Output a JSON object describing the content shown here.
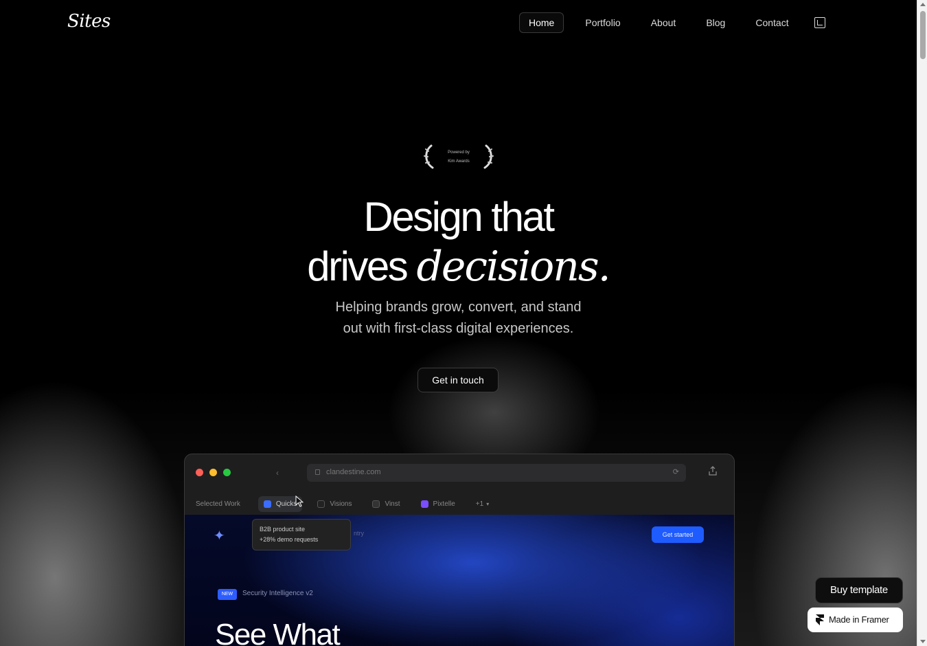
{
  "brand": {
    "logo": "Sites"
  },
  "nav": {
    "items": [
      {
        "label": "Home",
        "active": true
      },
      {
        "label": "Portfolio",
        "active": false
      },
      {
        "label": "About",
        "active": false
      },
      {
        "label": "Blog",
        "active": false
      },
      {
        "label": "Contact",
        "active": false
      }
    ],
    "extra_icon": "external-link-icon"
  },
  "award": {
    "line1": "Powered by",
    "line2": "Kim Awards"
  },
  "hero": {
    "title_line1": "Design that",
    "title_line2_plain": "drives ",
    "title_line2_italic": "decisions.",
    "subtitle_line1": "Helping brands grow, convert, and stand",
    "subtitle_line2": "out with first-class digital experiences.",
    "cta_label": "Get in touch"
  },
  "browser": {
    "traffic_light_colors": [
      "#ff5f57",
      "#febc2e",
      "#28c840"
    ],
    "url": "clandestine.com",
    "tabs_label": "Selected Work",
    "tabs": [
      {
        "label": "Quicks",
        "icon": "sparkle-icon",
        "color": "#3b6cff",
        "active": true
      },
      {
        "label": "Visions",
        "icon": "leaf-icon",
        "color": "#222222",
        "active": false
      },
      {
        "label": "Vinst",
        "icon": "wave-icon",
        "color": "#333333",
        "active": false
      },
      {
        "label": "Pixtelle",
        "icon": "square-icon",
        "color": "#7a4dff",
        "active": false
      },
      {
        "label": "+1",
        "icon": "chevron-down-icon",
        "color": "#888888",
        "active": false
      }
    ],
    "tooltip_line1": "B2B product site",
    "tooltip_line2": "+28% demo requests",
    "tooltip_suffix": "ntry",
    "get_started": "Get started",
    "badge_new": "NEW",
    "badge_text": "Security Intelligence v2",
    "headline": "See What"
  },
  "floating": {
    "buy_label": "Buy template",
    "framer_label": "Made in Framer"
  }
}
